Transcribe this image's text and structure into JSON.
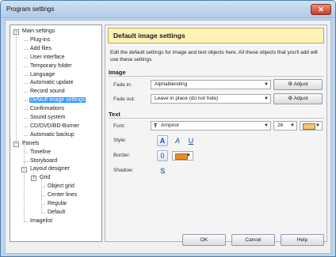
{
  "window": {
    "title": "Program settings"
  },
  "tree": [
    {
      "label": "Main settings",
      "level": 0,
      "expander": "-"
    },
    {
      "label": "Plug-ins",
      "level": 1
    },
    {
      "label": "Add files",
      "level": 1
    },
    {
      "label": "User interface",
      "level": 1
    },
    {
      "label": "Temporary folder",
      "level": 1
    },
    {
      "label": "Language",
      "level": 1
    },
    {
      "label": "Automatic update",
      "level": 1
    },
    {
      "label": "Record sound",
      "level": 1
    },
    {
      "label": "Default image settings",
      "level": 1,
      "selected": true
    },
    {
      "label": "Confirmations",
      "level": 1
    },
    {
      "label": "Sound system",
      "level": 1
    },
    {
      "label": "CD/DVD/BD-Burner",
      "level": 1
    },
    {
      "label": "Automatic backup",
      "level": 1
    },
    {
      "label": "Panels",
      "level": 0,
      "expander": "-"
    },
    {
      "label": "Timeline",
      "level": 1
    },
    {
      "label": "Storyboard",
      "level": 1
    },
    {
      "label": "Layout designer",
      "level": 1,
      "expander": "-"
    },
    {
      "label": "Grid",
      "level": 2,
      "expander": "-"
    },
    {
      "label": "Object grid",
      "level": 3
    },
    {
      "label": "Center lines",
      "level": 3
    },
    {
      "label": "Regular",
      "level": 3
    },
    {
      "label": "Default",
      "level": 3
    },
    {
      "label": "Imagelist",
      "level": 1
    }
  ],
  "panel": {
    "header": "Default image settings",
    "description": "Edit the default settings for image and text objects here. All these objects that you'll add will use these settings",
    "image_section": "Image",
    "fade_in_label": "Fade in:",
    "fade_in_value": "Alphablending",
    "fade_out_label": "Fade out:",
    "fade_out_value": "Leave in place (do not hide)",
    "adjust_label": "Adjust",
    "text_section": "Text",
    "font_label": "Font:",
    "font_value": "Arnprior",
    "font_size": "26",
    "style_label": "Style:",
    "border_label": "Border:",
    "shadow_label": "Shadow:",
    "style_icons": [
      "A",
      "A",
      "U"
    ],
    "shadow_icon": "S",
    "text_color": "#f5c56a",
    "border_color": "#f08a1c"
  },
  "buttons": {
    "ok": "OK",
    "cancel": "Cancel",
    "help": "Help"
  }
}
